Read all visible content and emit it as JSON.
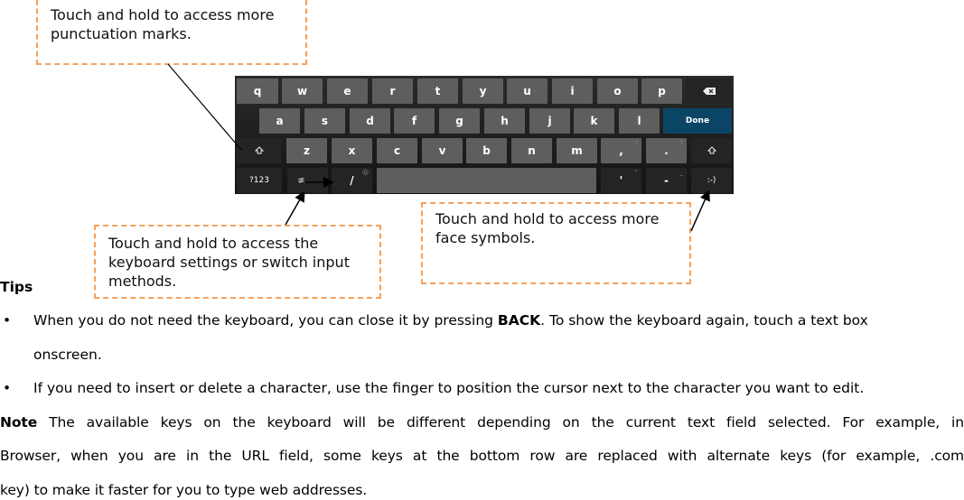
{
  "callouts": {
    "punctuation": "Touch and hold to access more punctuation marks.",
    "settings": "Touch and hold to access the keyboard settings or switch input methods.",
    "face": "Touch and hold to access more face symbols."
  },
  "keyboard": {
    "row1": [
      "q",
      "w",
      "e",
      "r",
      "t",
      "y",
      "u",
      "i",
      "o",
      "p"
    ],
    "backspace_icon": "backspace-icon",
    "row2": [
      "a",
      "s",
      "d",
      "f",
      "g",
      "h",
      "j",
      "k",
      "l"
    ],
    "done_label": "Done",
    "row3": [
      "z",
      "x",
      "c",
      "v",
      "b",
      "n",
      "m"
    ],
    "comma": ",",
    "comma_alt": "!",
    "period": ".",
    "period_alt": "?",
    "shift_icon": "shift-icon",
    "symbols_label": "?123",
    "settings_icon": "settings-icon",
    "slash": "/",
    "slash_alt": "@",
    "apostrophe": "'",
    "apostrophe_alt": "\"",
    "dash": "-",
    "dash_alt": "_",
    "smiley": ":-)"
  },
  "tips": {
    "heading": "Tips",
    "bullet": "•",
    "item1_a": "When you do not need the keyboard, you can close it by pressing ",
    "item1_bold": "BACK",
    "item1_b": ". To show the keyboard again, touch a text box",
    "item1_c": "onscreen.",
    "item2": "If you need to insert or delete a character, use the finger to position the cursor next to the character you want to edit."
  },
  "note": {
    "label": "Note",
    "line1": " The available keys on the keyboard will be different depending on the current text field selected. For example, in",
    "line2": "Browser, when you are in the URL field, some keys at the bottom row are replaced with alternate keys (for example, .com",
    "line3": "key) to make it faster for you to type web addresses."
  }
}
